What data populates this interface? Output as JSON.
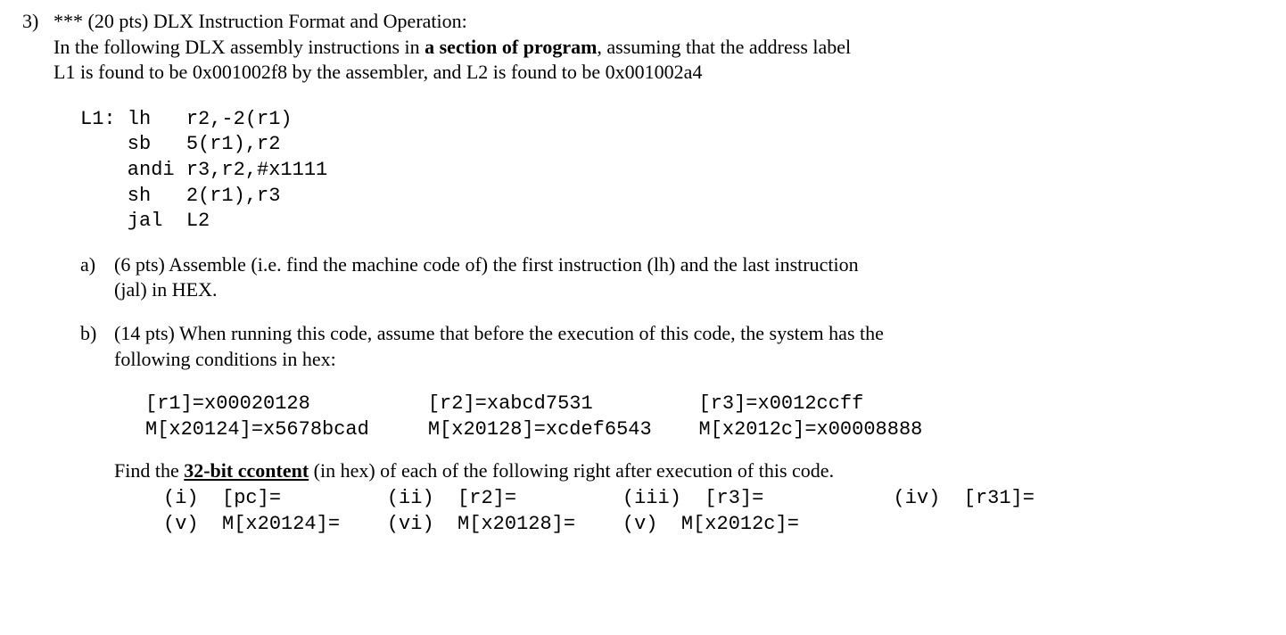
{
  "problem": {
    "number": "3)",
    "stars": "***",
    "points": "(20 pts)",
    "title": "DLX Instruction Format and Operation:",
    "intro1a": "In the following DLX assembly instructions in ",
    "intro1b": "a section of program",
    "intro1c": ", assuming that the address label",
    "intro2": "L1 is found to be 0x001002f8 by the assembler, and L2 is found to be 0x001002a4"
  },
  "code": "L1: lh   r2,-2(r1)\n    sb   5(r1),r2\n    andi r3,r2,#x1111\n    sh   2(r1),r3\n    jal  L2",
  "parta": {
    "label": "a)",
    "text1": "(6 pts) Assemble (i.e. find the machine code of) the first instruction (lh) and the last instruction",
    "text2": "(jal) in HEX."
  },
  "partb": {
    "label": "b)",
    "text1": "(14 pts) When running this code, assume that before the execution of this code, the system has the",
    "text2": "following conditions in hex:",
    "conditions": "[r1]=x00020128          [r2]=xabcd7531         [r3]=x0012ccff\nM[x20124]=x5678bcad     M[x20128]=xcdef6543    M[x2012c]=x00008888",
    "find1a": "Find the ",
    "find1b": "32-bit ccontent",
    "find1c": " (in hex) of each of the following right after execution of this code.",
    "answers1": "(i)  [pc]=         (ii)  [r2]=         (iii)  [r3]=           (iv)  [r31]=",
    "answers2": "(v)  M[x20124]=    (vi)  M[x20128]=    (v)  M[x2012c]="
  }
}
